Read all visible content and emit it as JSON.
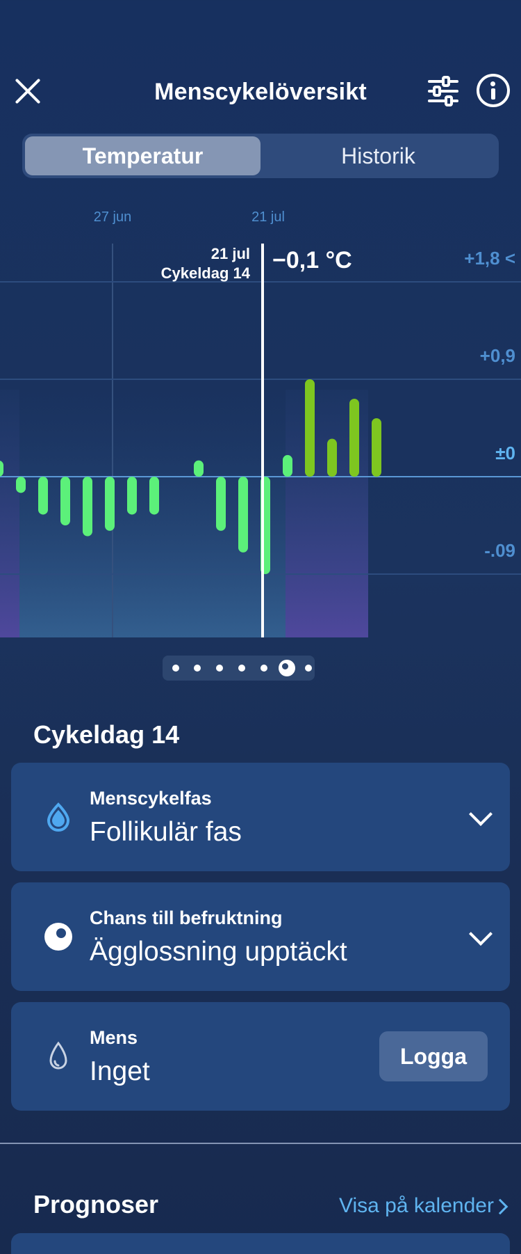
{
  "header": {
    "title": "Menscykelöversikt",
    "close_icon": "close-icon",
    "filter_icon": "sliders-icon",
    "info_icon": "info-icon"
  },
  "tabs": [
    {
      "label": "Temperatur",
      "active": true
    },
    {
      "label": "Historik",
      "active": false
    }
  ],
  "chart_data": {
    "type": "bar",
    "date_labels": [
      "27 jun",
      "21 jul"
    ],
    "y_ticks": [
      "+1,8 <",
      "+0,9",
      "±0",
      "-.09"
    ],
    "y_tick_values": [
      1.8,
      0.9,
      0,
      -0.9
    ],
    "selected": {
      "date": "21 jul",
      "day_label": "Cykeldag 14",
      "value_text": "−0,1 °C"
    },
    "values": [
      0.15,
      -0.15,
      -0.35,
      -0.45,
      -0.55,
      -0.5,
      -0.35,
      -0.35,
      null,
      0.15,
      -0.5,
      -0.7,
      -0.9,
      0.2,
      0.9,
      0.35,
      0.72,
      0.54
    ],
    "colors": {
      "phase_low": "#5cf07a",
      "phase_high": "#7ec620",
      "axis_labels": "#4f8fd0"
    }
  },
  "pager": {
    "count": 7,
    "active_index": 5
  },
  "cycle_day_title": "Cykeldag 14",
  "cards": [
    {
      "label": "Menscykelfas",
      "value": "Follikulär fas",
      "icon": "drop-filled-icon"
    },
    {
      "label": "Chans till befruktning",
      "value": "Ägglossning upptäckt",
      "icon": "egg-icon"
    },
    {
      "label": "Mens",
      "value": "Inget",
      "icon": "drop-outline-icon",
      "button": "Logga"
    }
  ],
  "forecasts": {
    "title": "Prognoser",
    "link": "Visa på kalender"
  }
}
